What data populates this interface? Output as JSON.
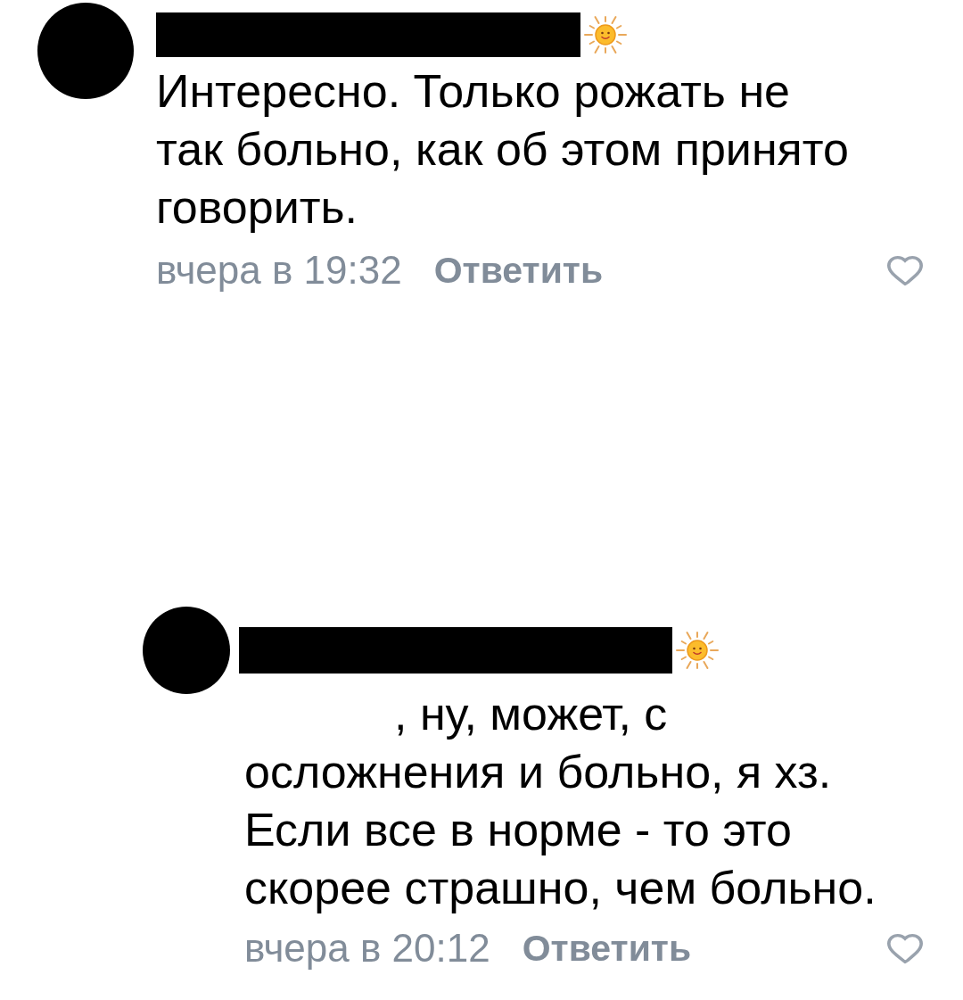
{
  "comments": [
    {
      "kind": "comment",
      "mention_hidden": false,
      "text": "Интересно. Только рожать не\nтак больно, как об этом принято\nговорить.",
      "time": "вчера в 19:32",
      "reply_label": "Ответить",
      "liked": false
    },
    {
      "kind": "reply",
      "mention_hidden": true,
      "text": ", ну, может, с\nосложнения и больно, я хз.\nЕсли все в норме - то это\nскорее страшно, чем больно.",
      "time": "вчера в 20:12",
      "reply_label": "Ответить",
      "liked": false
    }
  ]
}
